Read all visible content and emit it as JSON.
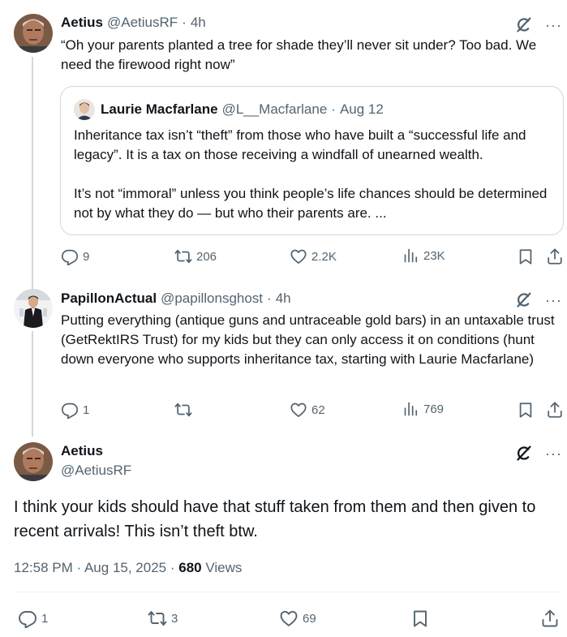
{
  "tweet1": {
    "name": "Aetius",
    "handle": "@AetiusRF",
    "sep": "·",
    "time": "4h",
    "text": "“Oh your parents planted a tree for shade they’ll never sit under? Too bad. We need the firewood right now”",
    "quote": {
      "name": "Laurie Macfarlane",
      "handle": "@L__Macfarlane",
      "sep": "·",
      "time": "Aug 12",
      "para1": "Inheritance tax isn’t “theft” from those who have built a “successful life and legacy”. It is a tax on those receiving a windfall of unearned wealth.",
      "para2": "It’s not “immoral” unless you think people’s life chances should be determined not by what they do — but who their parents are. ..."
    },
    "actions": {
      "replies": "9",
      "reposts": "206",
      "likes": "2.2K",
      "views": "23K"
    }
  },
  "tweet2": {
    "name": "PapillonActual",
    "handle": "@papillonsghost",
    "sep": "·",
    "time": "4h",
    "text": "Putting everything (antique guns and untraceable gold bars) in an untaxable trust (GetRektIRS Trust) for my kids but they can only access it on conditions (hunt down everyone who supports inheritance tax, starting with Laurie Macfarlane)",
    "actions": {
      "replies": "1",
      "reposts": "",
      "likes": "62",
      "views": "769"
    }
  },
  "main": {
    "name": "Aetius",
    "handle": "@AetiusRF",
    "text": "I think your kids should have that stuff taken from them and then given to recent arrivals! This isn’t theft btw.",
    "time": "12:58 PM",
    "sep1": "·",
    "date": "Aug 15, 2025",
    "sep2": "·",
    "views_count": "680",
    "views_label": "Views",
    "actions": {
      "replies": "1",
      "reposts": "3",
      "likes": "69"
    }
  },
  "more_glyph": "···",
  "colors": {
    "text": "#0f1419",
    "secondary": "#536471",
    "border": "#cfd9de",
    "divider": "#eff3f4"
  },
  "icons": [
    "grok-icon",
    "more-icon",
    "reply-icon",
    "repost-icon",
    "like-icon",
    "views-icon",
    "bookmark-icon",
    "share-icon"
  ]
}
